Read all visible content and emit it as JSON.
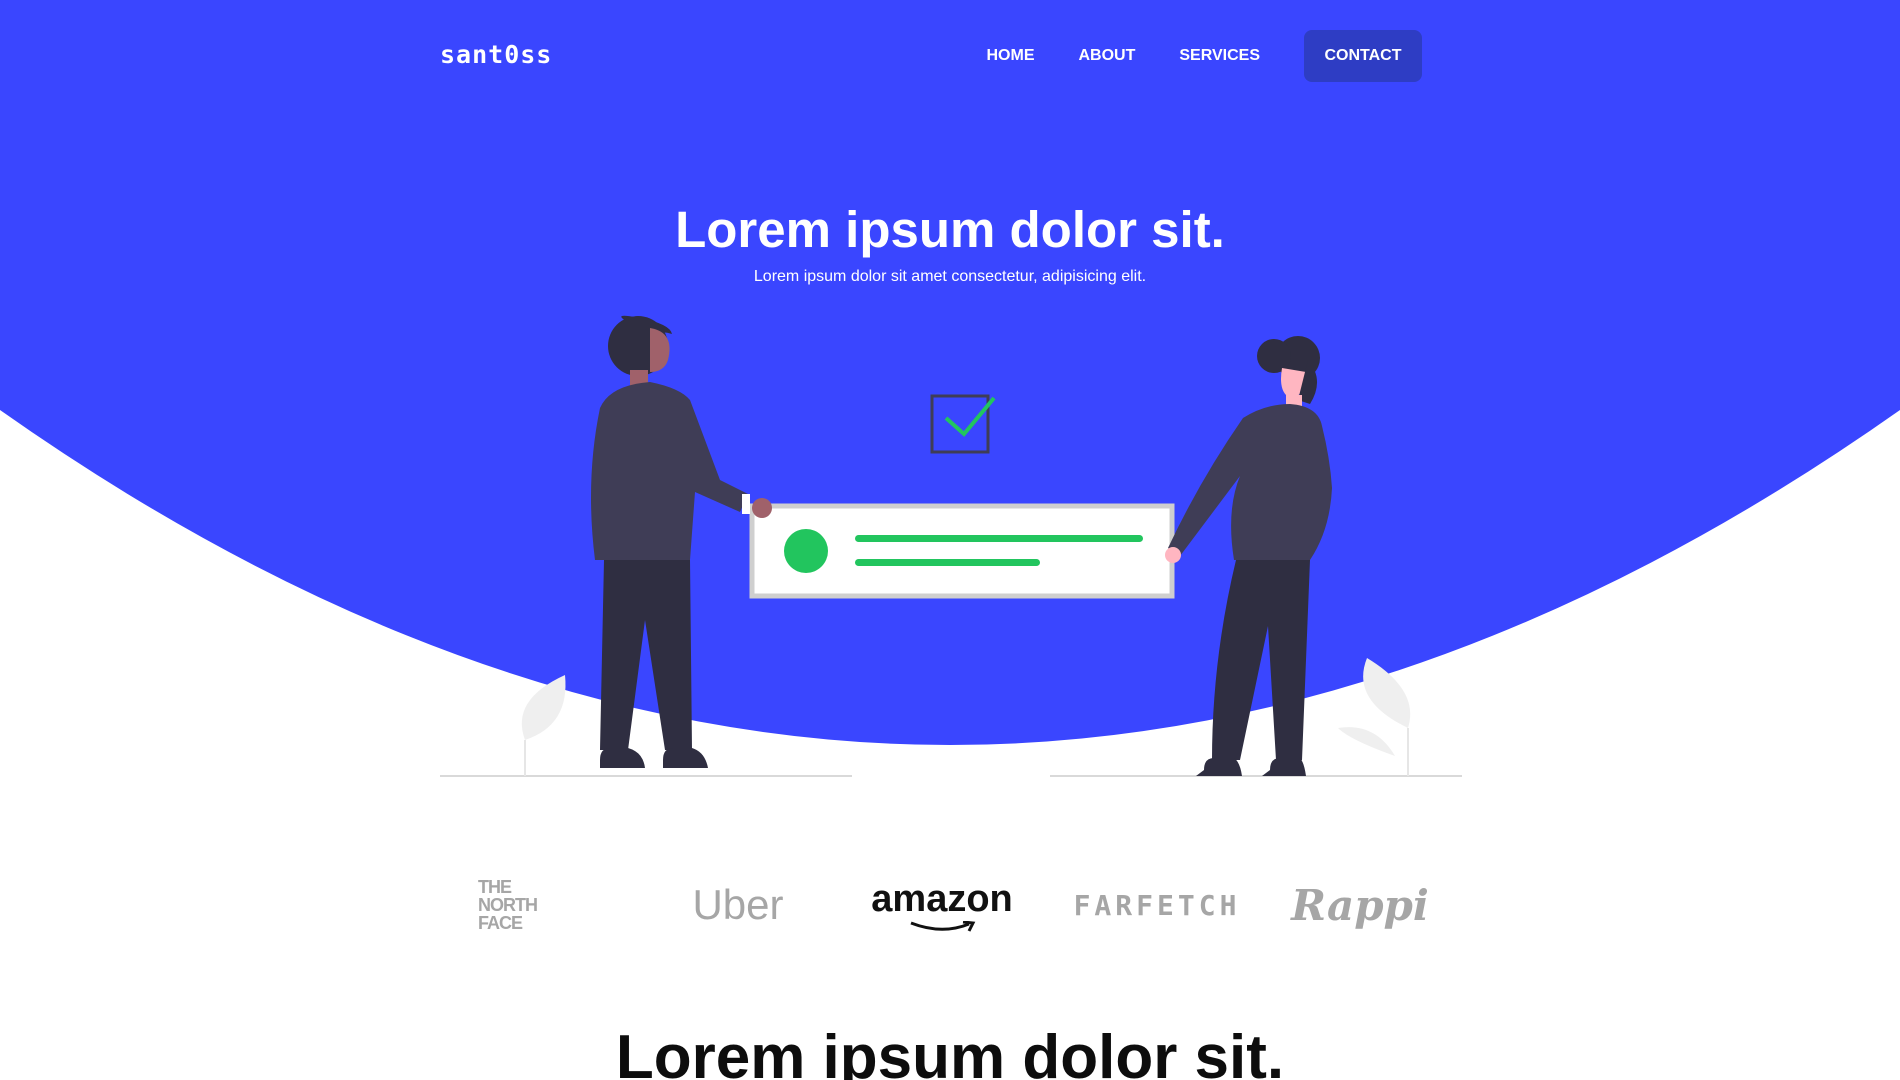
{
  "nav": {
    "logo": "sant0ss",
    "links": [
      "HOME",
      "ABOUT",
      "SERVICES"
    ],
    "contact_label": "CONTACT"
  },
  "hero": {
    "title": "Lorem ipsum dolor sit.",
    "subtitle": "Lorem ipsum dolor sit amet consectetur, adipisicing elit."
  },
  "brands": {
    "tnf_line1": "THE",
    "tnf_line2": "NORTH",
    "tnf_line3": "FACE",
    "uber": "Uber",
    "amazon": "amazon",
    "farfetch": "FARFETCH",
    "rappi": "Rappi"
  },
  "section": {
    "title": "Lorem ipsum dolor sit."
  },
  "colors": {
    "hero_blue": "#3a46ff",
    "contact_button": "#2e3dc4",
    "success_green": "#22c55e",
    "figure_dark": "#3f3d56",
    "brand_gray": "#a6a6a6"
  },
  "icons": {
    "checkbox": "check-square-icon",
    "status_dot": "green-dot-icon"
  }
}
